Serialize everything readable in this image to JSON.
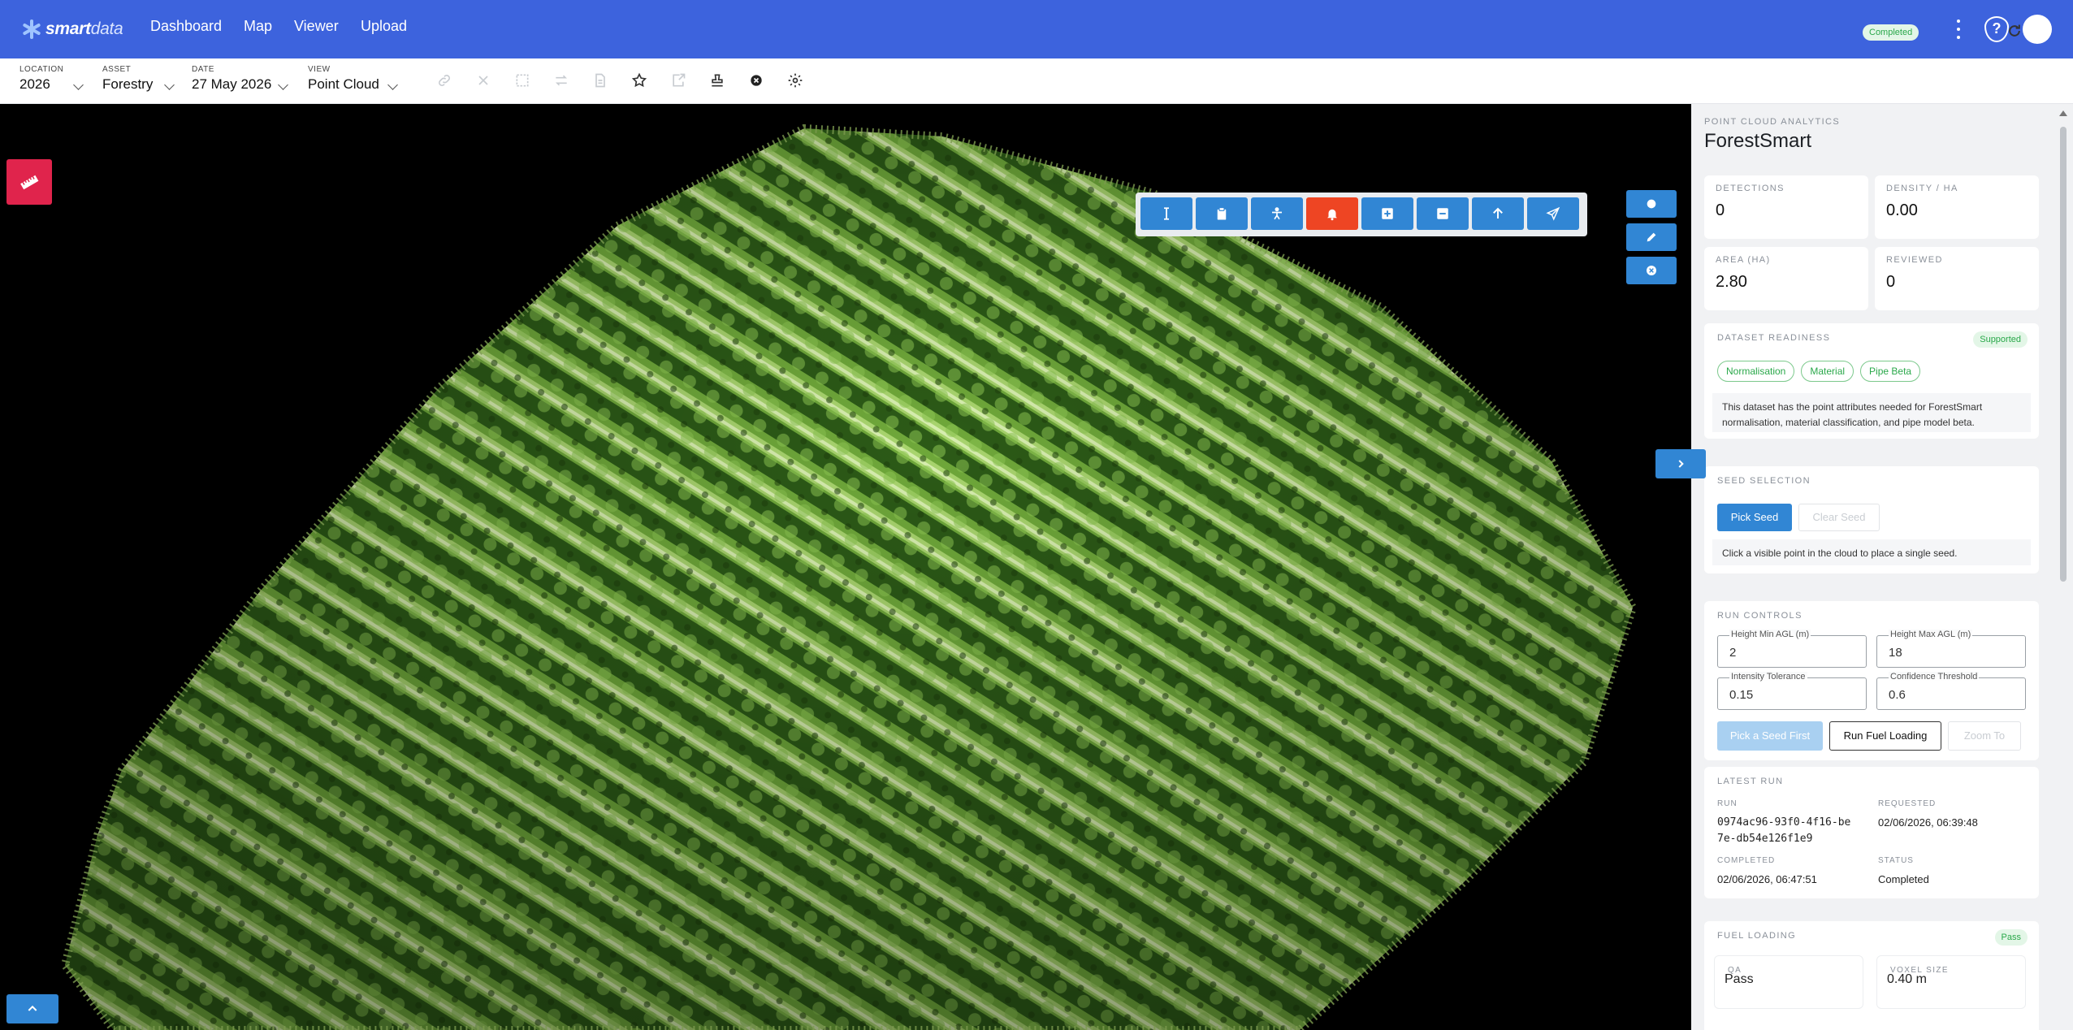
{
  "brand": {
    "name_bold": "smart",
    "name_light": "data"
  },
  "nav": {
    "links": [
      "Dashboard",
      "Map",
      "Viewer",
      "Upload"
    ]
  },
  "selectors": {
    "location": {
      "label": "LOCATION",
      "value": "2026"
    },
    "asset": {
      "label": "ASSET",
      "value": "Forestry"
    },
    "date": {
      "label": "DATE",
      "value": "27 May 2026"
    },
    "view": {
      "label": "VIEW",
      "value": "Point Cloud"
    }
  },
  "toolbar_icons": [
    "link-icon",
    "close-icon",
    "crop-icon",
    "swap-icon",
    "document-icon",
    "star-icon",
    "export-icon",
    "stamp-icon",
    "cancel-circle-icon",
    "settings-icon"
  ],
  "floating_tools": [
    "height-tool-icon",
    "clipboard-icon",
    "person-icon",
    "bell-icon",
    "plus-square-icon",
    "minus-square-icon",
    "arrow-up-icon",
    "send-icon"
  ],
  "colors": {
    "nav_bg": "#3d63dd",
    "tool_blue": "#3186d4",
    "alert_red": "#ee4523",
    "measure_pink": "#e0244c",
    "success_green": "#2aa84a"
  },
  "panel": {
    "kicker": "POINT CLOUD ANALYTICS",
    "title": "ForestSmart",
    "status": "Completed",
    "stats": [
      {
        "label": "DETECTIONS",
        "value": "0"
      },
      {
        "label": "DENSITY / HA",
        "value": "0.00"
      },
      {
        "label": "AREA (HA)",
        "value": "2.80"
      },
      {
        "label": "REVIEWED",
        "value": "0"
      }
    ],
    "readiness": {
      "title": "DATASET READINESS",
      "badge": "Supported",
      "chips": [
        "Normalisation",
        "Material",
        "Pipe Beta"
      ],
      "note": "This dataset has the point attributes needed for ForestSmart normalisation, material classification, and pipe model beta."
    },
    "seed": {
      "title": "SEED SELECTION",
      "pick_label": "Pick Seed",
      "clear_label": "Clear Seed",
      "note": "Click a visible point in the cloud to place a single seed."
    },
    "run_controls": {
      "title": "RUN CONTROLS",
      "fields": [
        {
          "label": "Height Min AGL (m)",
          "value": "2"
        },
        {
          "label": "Height Max AGL (m)",
          "value": "18"
        },
        {
          "label": "Intensity Tolerance",
          "value": "0.15"
        },
        {
          "label": "Confidence Threshold",
          "value": "0.6"
        }
      ],
      "pick_first_label": "Pick a Seed First",
      "run_label": "Run Fuel Loading",
      "zoom_label": "Zoom To"
    },
    "latest_run": {
      "title": "LATEST RUN",
      "run_label": "RUN",
      "run_value": "0974ac96-93f0-4f16-be7e-db54e126f1e9",
      "requested_label": "REQUESTED",
      "requested_value": "02/06/2026, 06:39:48",
      "completed_label": "COMPLETED",
      "completed_value": "02/06/2026, 06:47:51",
      "status_label": "STATUS",
      "status_value": "Completed"
    },
    "fuel_loading": {
      "title": "FUEL LOADING",
      "badge": "Pass",
      "items": [
        {
          "label": "QA",
          "value": "Pass"
        },
        {
          "label": "VOXEL SIZE",
          "value": "0.40 m"
        }
      ]
    }
  }
}
